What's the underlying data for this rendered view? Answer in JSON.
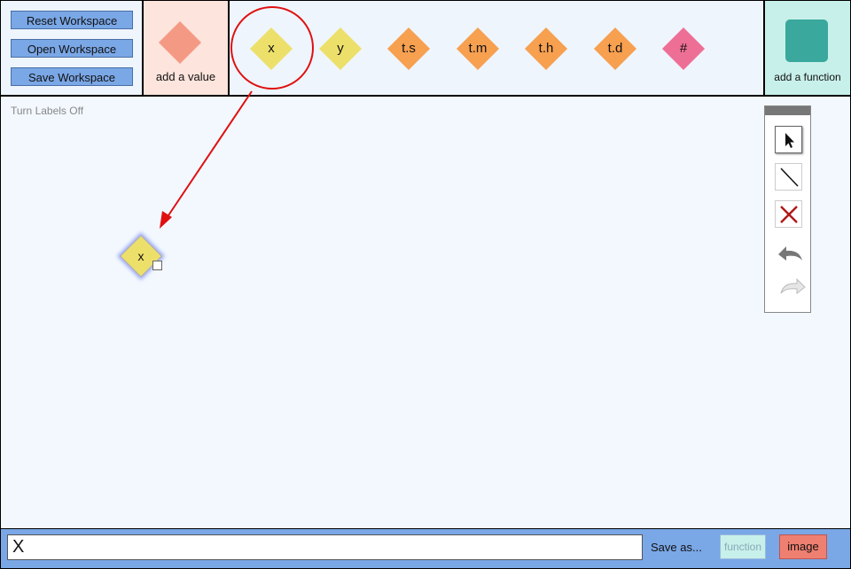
{
  "workspace_buttons": {
    "reset": "Reset Workspace",
    "open": "Open Workspace",
    "save": "Save Workspace"
  },
  "add_value": {
    "label": "add a value",
    "color": "#f49a84"
  },
  "palette": [
    {
      "label": "x",
      "color": "#ede06a"
    },
    {
      "label": "y",
      "color": "#ede06a"
    },
    {
      "label": "t.s",
      "color": "#f6a050"
    },
    {
      "label": "t.m",
      "color": "#f6a050"
    },
    {
      "label": "t.h",
      "color": "#f6a050"
    },
    {
      "label": "t.d",
      "color": "#f6a050"
    },
    {
      "label": "#",
      "color": "#ee6f96"
    }
  ],
  "add_function": {
    "label": "add a function",
    "color": "#3aa89c"
  },
  "workspace": {
    "labels_toggle": "Turn Labels Off",
    "node": {
      "label": "x",
      "color": "#ede06a"
    }
  },
  "toolbox": {
    "tools": [
      "pointer-icon",
      "line-icon",
      "delete-icon",
      "undo-icon",
      "redo-icon"
    ]
  },
  "bottombar": {
    "expression_value": "X",
    "save_as": "Save as...",
    "function_button": "function",
    "image_button": "image"
  },
  "annotation": {
    "color": "#e01010"
  }
}
